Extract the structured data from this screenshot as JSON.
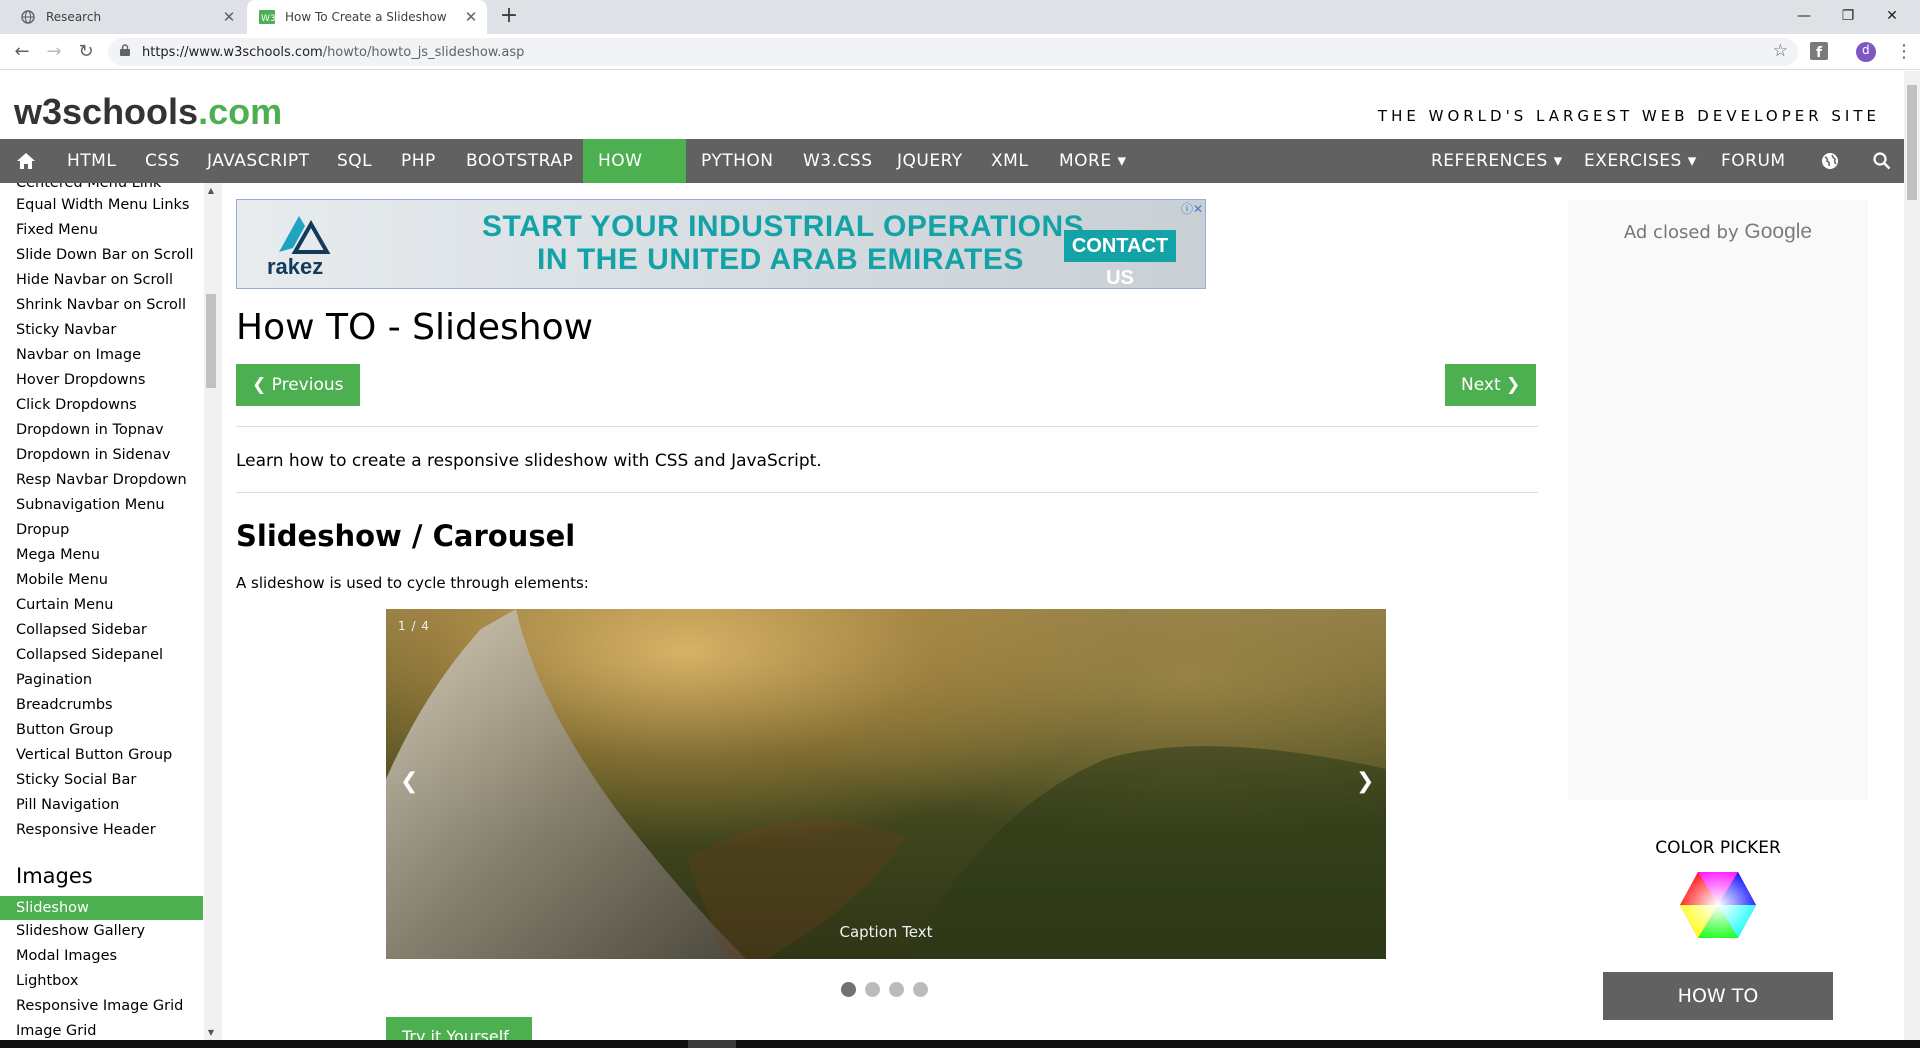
{
  "browser": {
    "tabs": [
      {
        "title": "Research",
        "icon": "globe-icon",
        "active": false
      },
      {
        "title": "How To Create a Slideshow",
        "icon": "w3schools-favicon",
        "active": true
      }
    ],
    "url_host": "https://www.w3schools.com",
    "url_path": "/howto/howto_js_slideshow.asp",
    "profile_initial": "d"
  },
  "header": {
    "logo_main": "w3schools",
    "logo_suffix": ".com",
    "slogan": "THE WORLD'S LARGEST WEB DEVELOPER SITE"
  },
  "topnav": {
    "items": [
      "HTML",
      "CSS",
      "JAVASCRIPT",
      "SQL",
      "PHP",
      "BOOTSTRAP",
      "HOW TO",
      "PYTHON",
      "W3.CSS",
      "JQUERY",
      "XML",
      "MORE ▾"
    ],
    "right_items": [
      "REFERENCES ▾",
      "EXERCISES ▾",
      "FORUM"
    ],
    "active": "HOW TO"
  },
  "sidebar": {
    "partial_top": "Centered Menu Link",
    "links": [
      "Equal Width Menu Links",
      "Fixed Menu",
      "Slide Down Bar on Scroll",
      "Hide Navbar on Scroll",
      "Shrink Navbar on Scroll",
      "Sticky Navbar",
      "Navbar on Image",
      "Hover Dropdowns",
      "Click Dropdowns",
      "Dropdown in Topnav",
      "Dropdown in Sidenav",
      "Resp Navbar Dropdown",
      "Subnavigation Menu",
      "Dropup",
      "Mega Menu",
      "Mobile Menu",
      "Curtain Menu",
      "Collapsed Sidebar",
      "Collapsed Sidepanel",
      "Pagination",
      "Breadcrumbs",
      "Button Group",
      "Vertical Button Group",
      "Sticky Social Bar",
      "Pill Navigation",
      "Responsive Header"
    ],
    "section_heading": "Images",
    "image_links": [
      "Slideshow",
      "Slideshow Gallery",
      "Modal Images",
      "Lightbox",
      "Responsive Image Grid",
      "Image Grid"
    ],
    "active": "Slideshow"
  },
  "ad": {
    "brand": "rakez",
    "line1": "START YOUR INDUSTRIAL OPERATIONS",
    "line2": "IN THE UNITED ARAB EMIRATES",
    "cta": "CONTACT US"
  },
  "main": {
    "title": "How TO - Slideshow",
    "prev_label": "❮ Previous",
    "next_label": "Next ❯",
    "intro": "Learn how to create a responsive slideshow with CSS and JavaScript.",
    "section_title": "Slideshow / Carousel",
    "section_desc": "A slideshow is used to cycle through elements:",
    "slide_number": "1 / 4",
    "slide_caption": "Caption Text",
    "slide_count": 4,
    "active_slide": 1,
    "tryit_label": "Try it Yourself »"
  },
  "right": {
    "ad_closed_text": "Ad closed by",
    "ad_closed_brand": "Google",
    "color_picker_title": "COLOR PICKER",
    "howto_label": "HOW TO"
  },
  "colors": {
    "w3_green": "#4CAF50",
    "nav_gray": "#616161"
  }
}
